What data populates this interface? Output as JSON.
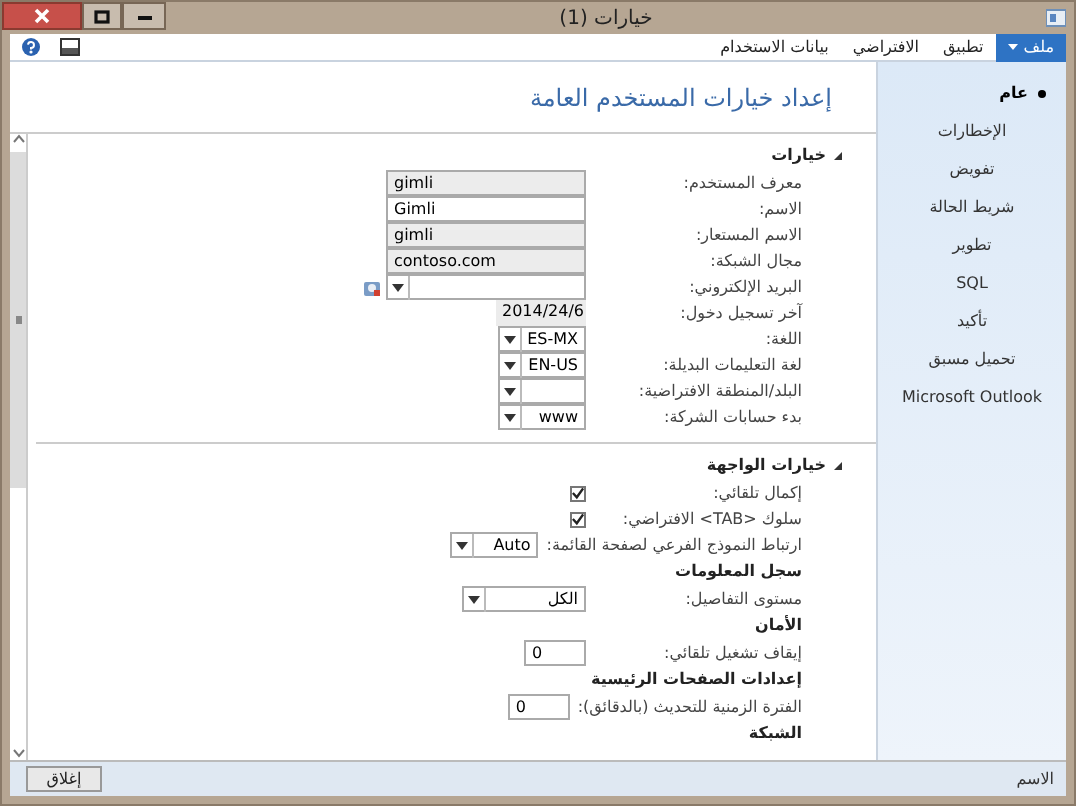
{
  "window": {
    "title": "خيارات (1)"
  },
  "menu": {
    "file": "ملف",
    "items": [
      "تطبيق",
      "الافتراضي",
      "بيانات الاستخدام"
    ]
  },
  "nav": [
    {
      "label": "عام",
      "selected": true
    },
    {
      "label": "الإخطارات",
      "selected": false
    },
    {
      "label": "تفويض",
      "selected": false
    },
    {
      "label": "شريط الحالة",
      "selected": false
    },
    {
      "label": "تطوير",
      "selected": false
    },
    {
      "label": "SQL",
      "selected": false
    },
    {
      "label": "تأكيد",
      "selected": false
    },
    {
      "label": "تحميل مسبق",
      "selected": false
    },
    {
      "label": "Microsoft Outlook",
      "selected": false
    }
  ],
  "heading": "إعداد خيارات المستخدم العامة",
  "sections": [
    {
      "title": "خيارات",
      "expanded": true,
      "items": [
        {
          "kind": "text",
          "label": "معرف المستخدم:",
          "value": "gimli",
          "readonly": true
        },
        {
          "kind": "text",
          "label": "الاسم:",
          "value": "Gimli",
          "readonly": false
        },
        {
          "kind": "text",
          "label": "الاسم المستعار:",
          "value": "gimli",
          "readonly": true
        },
        {
          "kind": "text",
          "label": "مجال الشبكة:",
          "value": "contoso.com",
          "readonly": true
        },
        {
          "kind": "email",
          "label": "البريد الإلكتروني:"
        },
        {
          "kind": "date",
          "label": "آخر تسجيل دخول:",
          "value": "2014/24/6"
        },
        {
          "kind": "combo",
          "label": "اللغة:",
          "value": "ES-MX"
        },
        {
          "kind": "combo",
          "label": "لغة التعليمات البديلة:",
          "value": "EN-US"
        },
        {
          "kind": "combo",
          "label": "البلد/المنطقة الافتراضية:"
        },
        {
          "kind": "combo",
          "label": "بدء حسابات الشركة:",
          "value": "www"
        }
      ]
    },
    {
      "title": "خيارات الواجهة",
      "expanded": true,
      "items": [
        {
          "kind": "checkbox",
          "label": "إكمال تلقائي:",
          "checked": true
        },
        {
          "kind": "checkbox",
          "label": "سلوك <TAB> الافتراضي:",
          "checked": true
        },
        {
          "kind": "combo",
          "label": "ارتباط النموذج الفرعي لصفحة القائمة:",
          "value": "Auto"
        },
        {
          "kind": "heading",
          "label": "سجل المعلومات"
        },
        {
          "kind": "wide_combo",
          "label": "مستوى التفاصيل:",
          "value": "الكل"
        },
        {
          "kind": "heading",
          "label": "الأمان"
        },
        {
          "kind": "number",
          "label": "إيقاف تشغيل تلقائي:",
          "value": "0"
        },
        {
          "kind": "heading",
          "label": "إعدادات الصفحات الرئيسية"
        },
        {
          "kind": "number",
          "label": "الفترة الزمنية للتحديث (بالدقائق):",
          "value": "0"
        },
        {
          "kind": "heading",
          "label": "الشبكة"
        }
      ]
    }
  ],
  "status": {
    "field": "الاسم",
    "close": "إغلاق"
  }
}
